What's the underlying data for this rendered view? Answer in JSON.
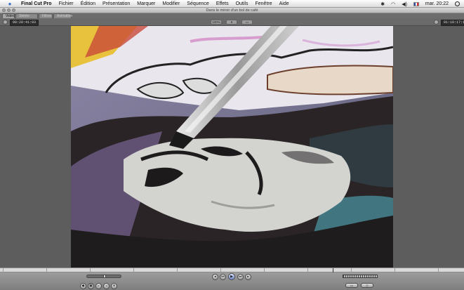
{
  "menubar": {
    "app_name": "Final Cut Pro",
    "items": [
      "Fichier",
      "Édition",
      "Présentation",
      "Marquer",
      "Modifier",
      "Séquence",
      "Effets",
      "Outils",
      "Fenêtre",
      "Aide"
    ],
    "clock": "mar. 20:22",
    "icons": [
      "bluetooth-icon",
      "wifi-icon",
      "volume-icon",
      "french-flag-icon",
      "spotlight-icon"
    ]
  },
  "window": {
    "title": "Dans le miroir d'un bol de café"
  },
  "tabs": [
    "Vidéo",
    "Stéréo (a1a2)",
    "Filtres",
    "Animation"
  ],
  "active_tab": 0,
  "viewer": {
    "duration_timecode": "00:28:41:03",
    "current_timecode": "01:18:17:11",
    "zoom_popup": "100%",
    "view_popup": "",
    "overlay_popup": ""
  },
  "playback": {
    "position_fraction": 0.72
  },
  "colors": {
    "accent": "#6d86c8",
    "window_bg": "#5d5d5d"
  }
}
